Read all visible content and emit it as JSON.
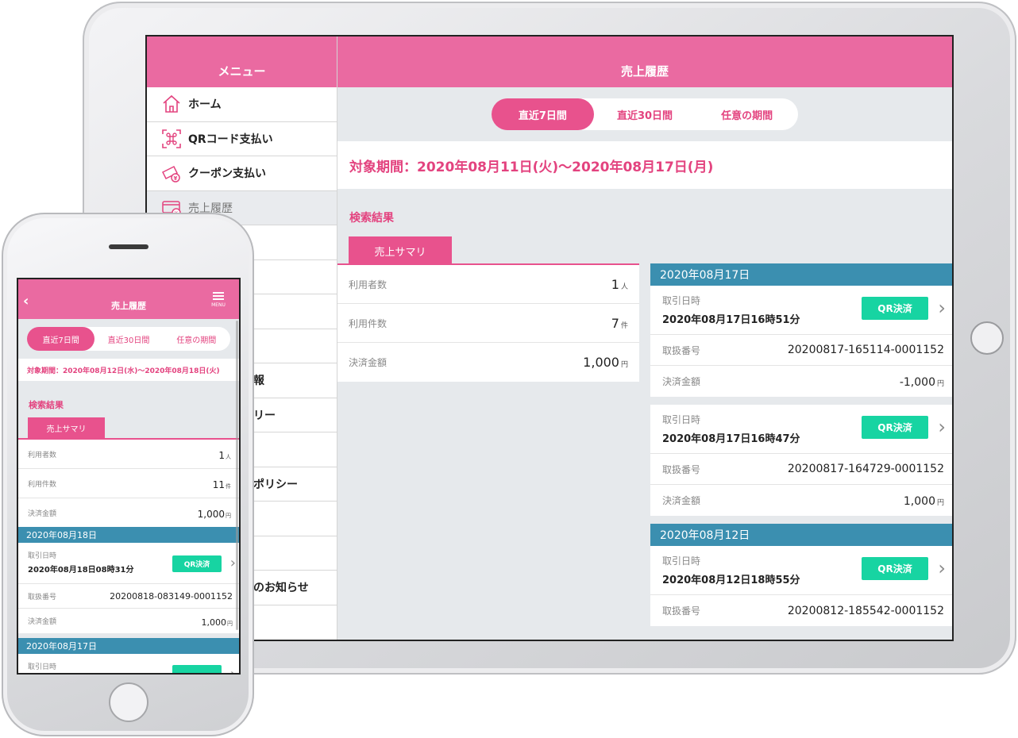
{
  "tablet": {
    "sidebar": {
      "title": "メニュー",
      "items": [
        {
          "label": "ホーム",
          "icon": "home-icon"
        },
        {
          "label": "QRコード支払い",
          "icon": "qr-scan-icon"
        },
        {
          "label": "クーポン支払い",
          "icon": "coupon-icon"
        },
        {
          "label": "売上履歴",
          "icon": "sales-history-icon"
        },
        {
          "label": "",
          "icon": ""
        },
        {
          "label": "",
          "icon": ""
        },
        {
          "label": "",
          "icon": ""
        },
        {
          "label": "",
          "icon": ""
        },
        {
          "label": "報",
          "icon": ""
        },
        {
          "label": "リー",
          "icon": ""
        },
        {
          "label": "",
          "icon": ""
        },
        {
          "label": "ポリシー",
          "icon": ""
        },
        {
          "label": "",
          "icon": ""
        },
        {
          "label": "",
          "icon": ""
        },
        {
          "label": "のお知らせ",
          "icon": ""
        }
      ]
    },
    "header": {
      "title": "売上履歴"
    },
    "period_tabs": [
      "直近7日間",
      "直近30日間",
      "任意の期間"
    ],
    "period_text": "対象期間：2020年08月11日(火)～2020年08月17日(月)",
    "result_label": "検索結果",
    "summary_tab": "売上サマリ",
    "summary": [
      {
        "label": "利用者数",
        "value": "1",
        "unit": "人"
      },
      {
        "label": "利用件数",
        "value": "7",
        "unit": "件"
      },
      {
        "label": "決済金額",
        "value": "1,000",
        "unit": "円"
      }
    ],
    "groups": [
      {
        "date": "2020年08月17日",
        "transactions": [
          {
            "datetime_label": "取引日時",
            "datetime": "2020年08月17日16時51分",
            "badge": "QR決済",
            "id_label": "取扱番号",
            "id": "20200817-165114-0001152",
            "amount_label": "決済金額",
            "amount": "-1,000",
            "unit": "円"
          },
          {
            "datetime_label": "取引日時",
            "datetime": "2020年08月17日16時47分",
            "badge": "QR決済",
            "id_label": "取扱番号",
            "id": "20200817-164729-0001152",
            "amount_label": "決済金額",
            "amount": "1,000",
            "unit": "円"
          }
        ]
      },
      {
        "date": "2020年08月12日",
        "transactions": [
          {
            "datetime_label": "取引日時",
            "datetime": "2020年08月12日18時55分",
            "badge": "QR決済",
            "id_label": "取扱番号",
            "id": "20200812-185542-0001152"
          }
        ]
      }
    ]
  },
  "phone": {
    "header": {
      "title": "売上履歴",
      "menu_label": "MENU"
    },
    "period_tabs": [
      "直近7日間",
      "直近30日間",
      "任意の期間"
    ],
    "period_text": "対象期間：2020年08月12日(水)～2020年08月18日(火)",
    "result_label": "検索結果",
    "summary_tab": "売上サマリ",
    "summary": [
      {
        "label": "利用者数",
        "value": "1",
        "unit": "人"
      },
      {
        "label": "利用件数",
        "value": "11",
        "unit": "件"
      },
      {
        "label": "決済金額",
        "value": "1,000",
        "unit": "円"
      }
    ],
    "groups": [
      {
        "date": "2020年08月18日",
        "transactions": [
          {
            "datetime_label": "取引日時",
            "datetime": "2020年08月18日08時31分",
            "badge": "QR決済",
            "id_label": "取扱番号",
            "id": "20200818-083149-0001152",
            "amount_label": "決済金額",
            "amount": "1,000",
            "unit": "円"
          }
        ]
      },
      {
        "date": "2020年08月17日",
        "transactions": [
          {
            "datetime_label": "取引日時"
          }
        ]
      }
    ]
  },
  "colors": {
    "brand_pink": "#ea6aa1",
    "accent_pink": "#e3437f",
    "date_header_blue": "#3b8fb0",
    "qr_badge_green": "#17d4a2"
  }
}
